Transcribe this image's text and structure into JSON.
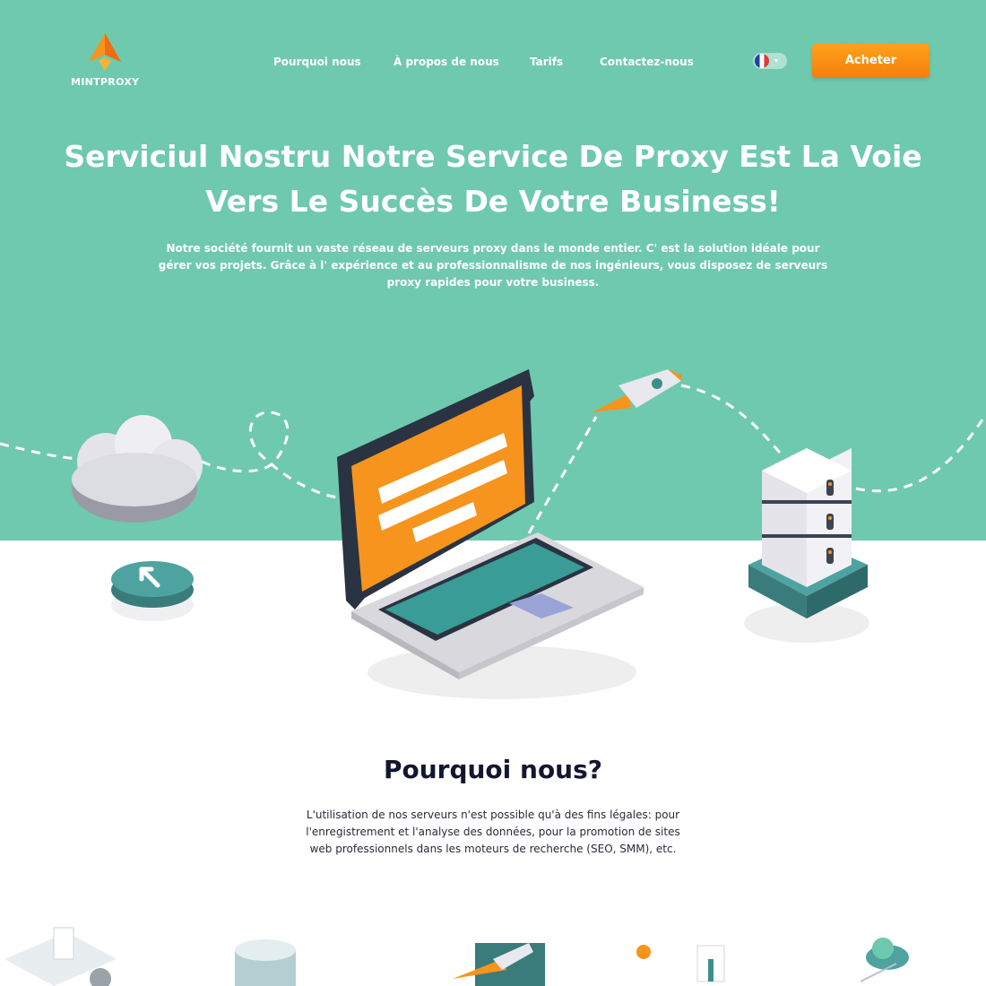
{
  "brand": {
    "name": "MINTPROXY",
    "colors": {
      "mint": "#6fc9ae",
      "orange": "#f7941d",
      "dark": "#14152e",
      "teal": "#3f8e8e"
    }
  },
  "nav": {
    "items": [
      {
        "label": "Pourquoi nous"
      },
      {
        "label": "À propos de nous"
      },
      {
        "label": "Tarifs"
      },
      {
        "label": "Contactez-nous"
      }
    ],
    "language": {
      "flag": "france-flag-icon",
      "caret": "▾"
    },
    "buy_label": "Acheter"
  },
  "hero": {
    "title": "Serviciul Nostru Notre Service De Proxy Est La Voie Vers Le Succès De Votre Business!",
    "description": "Notre société fournit un vaste réseau de serveurs proxy dans le monde entier. C' est la solution idéale pour gérer vos projets. Grâce à l' expérience et au professionnalisme de nos ingénieurs, vous disposez de serveurs proxy rapides pour votre business."
  },
  "why": {
    "title": "Pourquoi nous?",
    "description": "L'utilisation de nos serveurs n'est possible qu'à des fins légales: pour l'enregistrement et l'analyse des données, pour la promotion de sites web professionnels dans les moteurs de recherche (SEO, SMM), etc."
  },
  "icons": [
    "logo-rocket-icon",
    "cloud-icon",
    "laptop-icon",
    "rocket-icon",
    "server-rack-icon",
    "cursor-button-icon",
    "france-flag-icon"
  ]
}
